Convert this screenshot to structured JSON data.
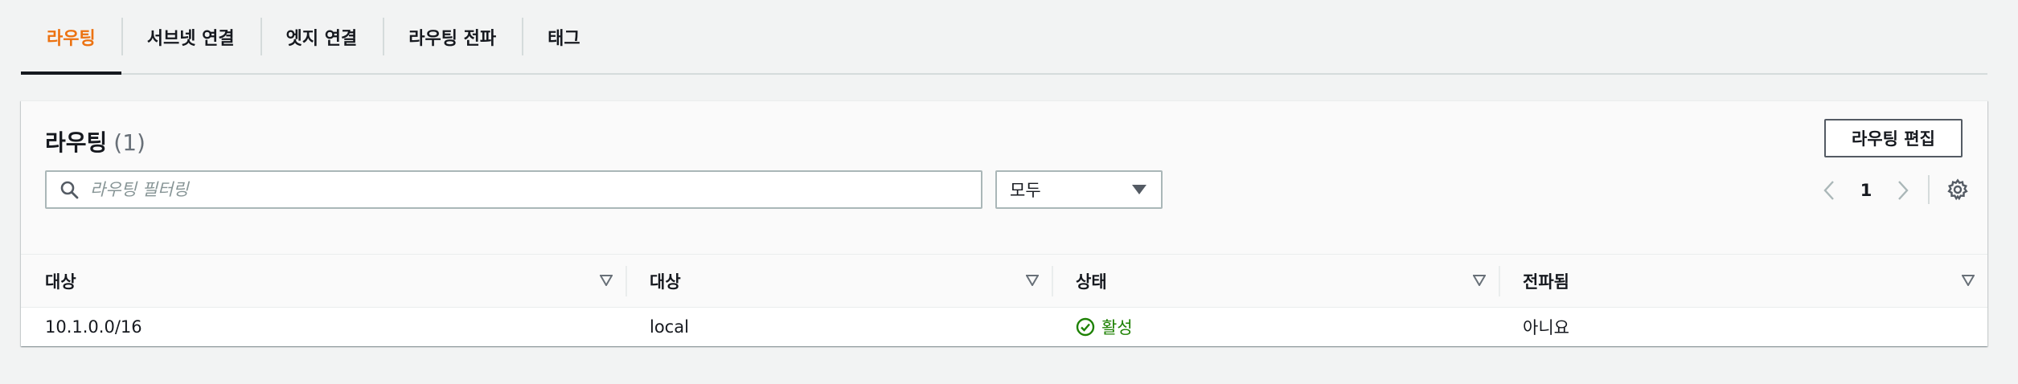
{
  "tabs": [
    {
      "label": "라우팅",
      "active": true
    },
    {
      "label": "서브넷 연결",
      "active": false
    },
    {
      "label": "엣지 연결",
      "active": false
    },
    {
      "label": "라우팅 전파",
      "active": false
    },
    {
      "label": "태그",
      "active": false
    }
  ],
  "panel": {
    "title": "라우팅",
    "count": "(1)",
    "edit_button": "라우팅 편집"
  },
  "filter": {
    "placeholder": "라우팅 필터링",
    "value": "",
    "select_value": "모두"
  },
  "pagination": {
    "current_page": "1"
  },
  "table": {
    "columns": [
      "대상",
      "대상",
      "상태",
      "전파됨"
    ],
    "rows": [
      {
        "destination": "10.1.0.0/16",
        "target": "local",
        "status": "활성",
        "propagated": "아니요"
      }
    ]
  },
  "colors": {
    "accent": "#ec7211",
    "status_active": "#1d8102"
  },
  "icons": {
    "search": "search-icon",
    "dropdown": "caret-down-icon",
    "prev": "chevron-left-icon",
    "next": "chevron-right-icon",
    "settings": "gear-icon",
    "sort": "sort-down-icon",
    "status": "check-circle-icon"
  }
}
